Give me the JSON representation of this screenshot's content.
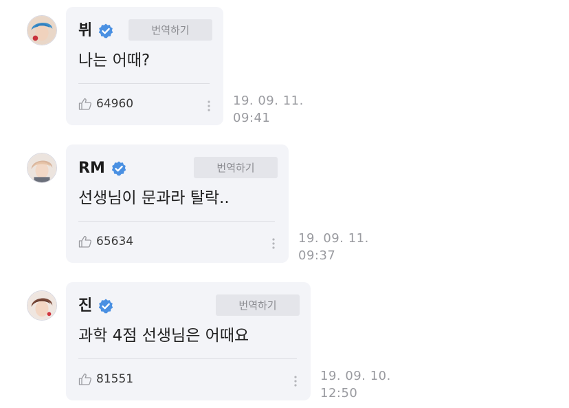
{
  "comments": [
    {
      "author": "뷔",
      "translate_label": "번역하기",
      "text": "나는 어때?",
      "likes": "64960",
      "date": "19. 09. 11.",
      "time": "09:41",
      "avatar_color": "#3f8fc9"
    },
    {
      "author": "RM",
      "translate_label": "번역하기",
      "text": "선생님이 문과라 탈락..",
      "likes": "65634",
      "date": "19. 09. 11.",
      "time": "09:37",
      "avatar_color": "#d9b59c"
    },
    {
      "author": "진",
      "translate_label": "번역하기",
      "text": "과학 4점 선생님은 어때요",
      "likes": "81551",
      "date": "19. 09. 10.",
      "time": "12:50",
      "avatar_color": "#7a4a3a"
    }
  ],
  "colors": {
    "bubble_bg": "#f3f4f8",
    "verified": "#4a90e2",
    "timestamp": "#9a9ba0",
    "translate_bg": "#e4e5ea"
  },
  "icons": {
    "verified": "verified-check-icon",
    "like": "thumbs-up-icon",
    "more": "vertical-dots-icon"
  }
}
